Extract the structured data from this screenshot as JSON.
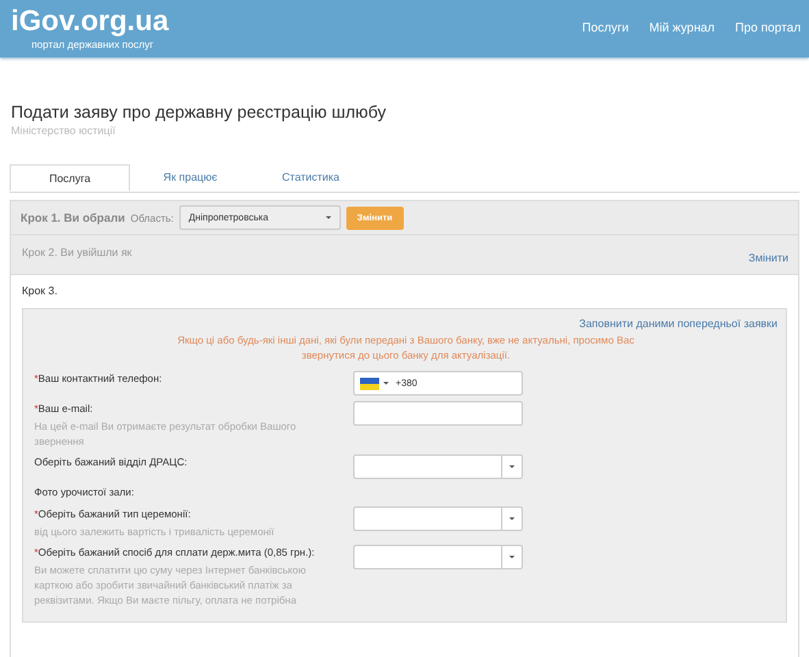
{
  "header": {
    "logo": "iGov.org.ua",
    "tagline": "портал державних послуг",
    "nav": [
      "Послуги",
      "Мій журнал",
      "Про портал"
    ]
  },
  "page": {
    "title": "Подати заяву про державну реєстрацію шлюбу",
    "subtitle": "Міністерство юстиції"
  },
  "tabs": [
    {
      "label": "Послуга",
      "selected": true
    },
    {
      "label": "Як працює",
      "selected": false
    },
    {
      "label": "Статистика",
      "selected": false
    }
  ],
  "step1": {
    "label": "Крок 1. Ви обрали",
    "region_label": "Область:",
    "region_value": "Дніпропетровська",
    "change_button": "Змінити"
  },
  "step2": {
    "label": "Крок 2. Ви увійшли як",
    "change_link": "Змінити"
  },
  "step3": {
    "label": "Крок 3.",
    "prefill_link": "Заповнити даними попередньої заявки",
    "warning": "Якщо ці або будь-які інші дані, які були передані з Вашого банку, вже не актуальні, просимо Вас звернутися до цього банку для актуалізації.",
    "fields": [
      {
        "kind": "phone",
        "label": "Ваш контактний телефон:",
        "required_mark": "*",
        "value": "+380"
      },
      {
        "kind": "text",
        "label": "Ваш e-mail:",
        "required_mark": "*",
        "hint": "На цей e-mail Ви отримаєте результат обробки Вашого звернення"
      },
      {
        "kind": "select",
        "label": "Оберіть бажаний відділ ДРАЦС:"
      },
      {
        "kind": "label",
        "label": "Фото урочистої зали:"
      },
      {
        "kind": "select",
        "label": "Оберіть бажаний тип церемонії:",
        "required_mark": "*",
        "hint": "від цього залежить вартість і тривалість церемонії"
      },
      {
        "kind": "select",
        "label": "Оберіть бажаний спосіб для сплати держ.мита (0,85 грн.):",
        "required_mark": "*",
        "hint": "Ви можете сплатити цю суму через Інтернет банківською карткою або зробити звичайний банківський платіж за реквізитами. Якщо Ви маєте пільгу, оплата не потрібна"
      }
    ]
  }
}
